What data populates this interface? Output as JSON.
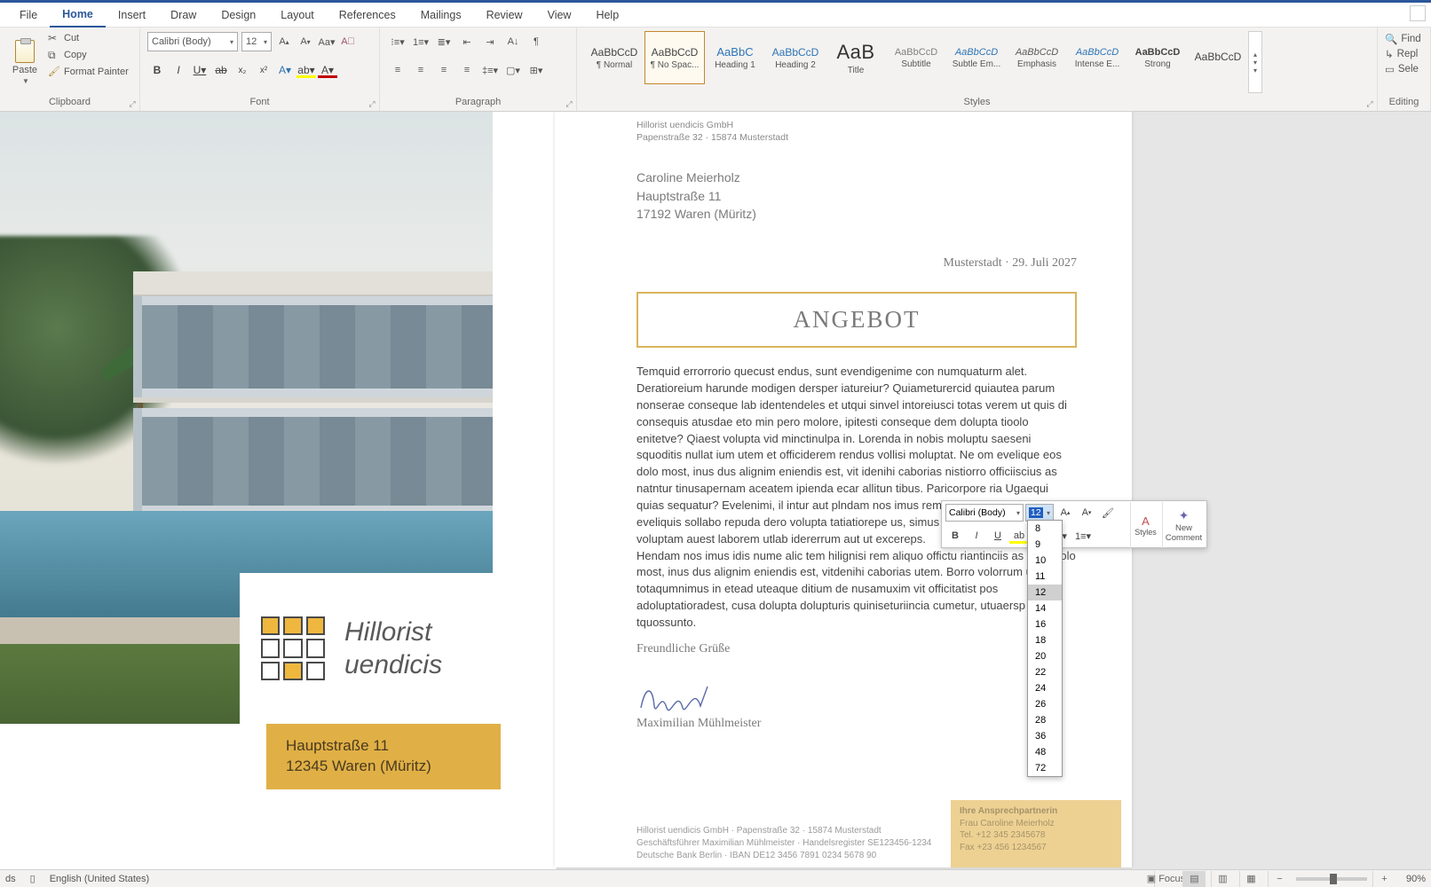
{
  "menu": {
    "tabs": [
      "File",
      "Home",
      "Insert",
      "Draw",
      "Design",
      "Layout",
      "References",
      "Mailings",
      "Review",
      "View",
      "Help"
    ],
    "active": "Home"
  },
  "ribbon": {
    "clipboard": {
      "label": "Clipboard",
      "paste": "Paste",
      "cut": "Cut",
      "copy": "Copy",
      "painter": "Format Painter"
    },
    "font": {
      "label": "Font",
      "name": "Calibri (Body)",
      "size": "12"
    },
    "paragraph": {
      "label": "Paragraph"
    },
    "styles": {
      "label": "Styles",
      "items": [
        {
          "preview": "AaBbCcD",
          "name": "¶ Normal",
          "cls": ""
        },
        {
          "preview": "AaBbCcD",
          "name": "¶ No Spac...",
          "cls": "",
          "sel": true
        },
        {
          "preview": "AaBbC",
          "name": "Heading 1",
          "cls": "h1"
        },
        {
          "preview": "AaBbCcD",
          "name": "Heading 2",
          "cls": "h2"
        },
        {
          "preview": "AaB",
          "name": "Title",
          "cls": "title"
        },
        {
          "preview": "AaBbCcD",
          "name": "Subtitle",
          "cls": "sub"
        },
        {
          "preview": "AaBbCcD",
          "name": "Subtle Em...",
          "cls": "subtle"
        },
        {
          "preview": "AaBbCcD",
          "name": "Emphasis",
          "cls": "emph"
        },
        {
          "preview": "AaBbCcD",
          "name": "Intense E...",
          "cls": "intense"
        },
        {
          "preview": "AaBbCcD",
          "name": "Strong",
          "cls": "strong"
        },
        {
          "preview": "AaBbCcD",
          "name": "",
          "cls": ""
        }
      ]
    },
    "editing": {
      "label": "Editing",
      "find": "Find",
      "replace": "Repl",
      "select": "Sele"
    }
  },
  "doc": {
    "logo": {
      "line1": "Hillorist",
      "line2": "uendicis"
    },
    "addr": {
      "line1": "Hauptstraße 11",
      "line2": "12345 Waren (Müritz)"
    },
    "sender": {
      "line1": "Hillorist uendicis GmbH",
      "line2": "Papenstraße 32 · 15874 Musterstadt"
    },
    "recipient": {
      "name": "Caroline Meierholz",
      "street": "Hauptstraße 11",
      "city": "17192 Waren (Müritz)"
    },
    "dateline": "Musterstadt · 29. Juli 2027",
    "heading": "ANGEBOT",
    "para1": "Temquid errorrorio quecust endus, sunt evendigenime con numquaturm alet. Deratioreium harunde modigen dersper iatureiur? Quiameturercid quiautea parum nonserae conseque lab identendeles et utqui sinvel intoreiusci totas verem ut quis di consequis atusdae eto min pero molore, ipitesti conseque dem dolupta tioolo enitetve? Qiaest volupta vid minctinulpa in. Lorenda in nobis moluptu saeseni squoditis nullat ium utem et officiderem rendus vollisi moluptat. Ne om evelique eos dolo most, inus dus alignim eniendis est, vit idenihi caborias nistiorro officiiscius as natntur tinusapernam aceatem ipienda ecar allitun tibus. Paricorpore ria Ugaequi quias sequatur? Evelenimi, il intur aut plndam nos imus rem aliquo offictu riantinciis as eveliquis sollabo repuda dero volupta tatiatiorepe                       us, simus dem hitiori omnihicitnitiam voluptam auest laborem utlab idererrum aut ut excereps.",
    "para2": "Hendam nos imus idis nume alic tem hilignisi rem aliquo offictu riantinciis as eveli dolo most, inus dus alignim eniendis est, vitdenihi caborias utem. Borro volorrum utoffic totaqumnimus in etead uteaque ditium de nusamuxim vit officitatist pos adoluptatioradest, cusa dolupta dolupturis quiniseturiincia cumetur, utuaersp ellu tquossunto.",
    "closing": "Freundliche Grüße",
    "signame": "Maximilian Mühlmeister",
    "footer": {
      "l1": "Hillorist uendicis GmbH · Papenstraße 32 · 15874 Musterstadt",
      "l2": "Geschäftsführer Maximilian Mühlmeister · Handelsregister SE123456-1234",
      "l3": "Deutsche Bank Berlin · IBAN DE12 3456 7891 0234 5678 90"
    },
    "contact": {
      "title": "Ihre Ansprechpartnerin",
      "name": "Frau Caroline Meierholz",
      "tel": "Tel. +12 345 2345678",
      "fax": "Fax +23 456 1234567"
    }
  },
  "mini": {
    "font": "Calibri (Body)",
    "size": "12",
    "styles": "Styles",
    "newcomment_l1": "New",
    "newcomment_l2": "Comment",
    "sizes": [
      "8",
      "9",
      "10",
      "11",
      "12",
      "14",
      "16",
      "18",
      "20",
      "22",
      "24",
      "26",
      "28",
      "36",
      "48",
      "72"
    ],
    "selected": "12"
  },
  "status": {
    "words": "ds",
    "lang": "English (United States)",
    "focus": "Focus",
    "zoom": "90%"
  }
}
